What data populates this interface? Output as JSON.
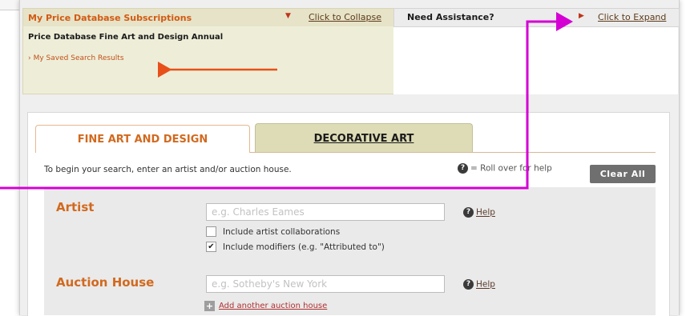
{
  "subscriptions": {
    "title": "My Price Database Subscriptions",
    "collapse_label": "Click to Collapse",
    "database_name": "Price Database Fine Art and Design Annual",
    "saved_search_label": "My Saved Search Results"
  },
  "assistance": {
    "title": "Need Assistance?",
    "expand_label": "Click to Expand"
  },
  "tabs": {
    "fine_art": "FINE ART AND DESIGN",
    "decorative": "DECORATIVE ART"
  },
  "instructions": {
    "text": "To begin your search, enter an artist and/or auction house.",
    "rollover": "= Roll over for help",
    "help_glyph": "?"
  },
  "buttons": {
    "clear_all": "Clear All"
  },
  "artist": {
    "label": "Artist",
    "placeholder": "e.g. Charles Eames",
    "help": "Help",
    "collab_label": "Include artist collaborations",
    "collab_checked": false,
    "modifiers_label": "Include modifiers (e.g. \"Attributed to\")",
    "modifiers_checked": true
  },
  "auction_house": {
    "label": "Auction House",
    "placeholder": "e.g. Sotheby's New York",
    "help": "Help",
    "add_another": "Add another auction house"
  },
  "icons": {
    "help": "question-circle-icon",
    "collapse": "triangle-down-icon",
    "expand": "triangle-right-icon",
    "add": "plus-box-icon",
    "checkmark": "✔"
  },
  "colors": {
    "accent_orange": "#d2691e",
    "subscriptions_bg": "#eeeed8",
    "decorative_tab_bg": "#dedcb6",
    "annotation_magenta": "#d400d4",
    "annotation_orange": "#e8501a"
  }
}
